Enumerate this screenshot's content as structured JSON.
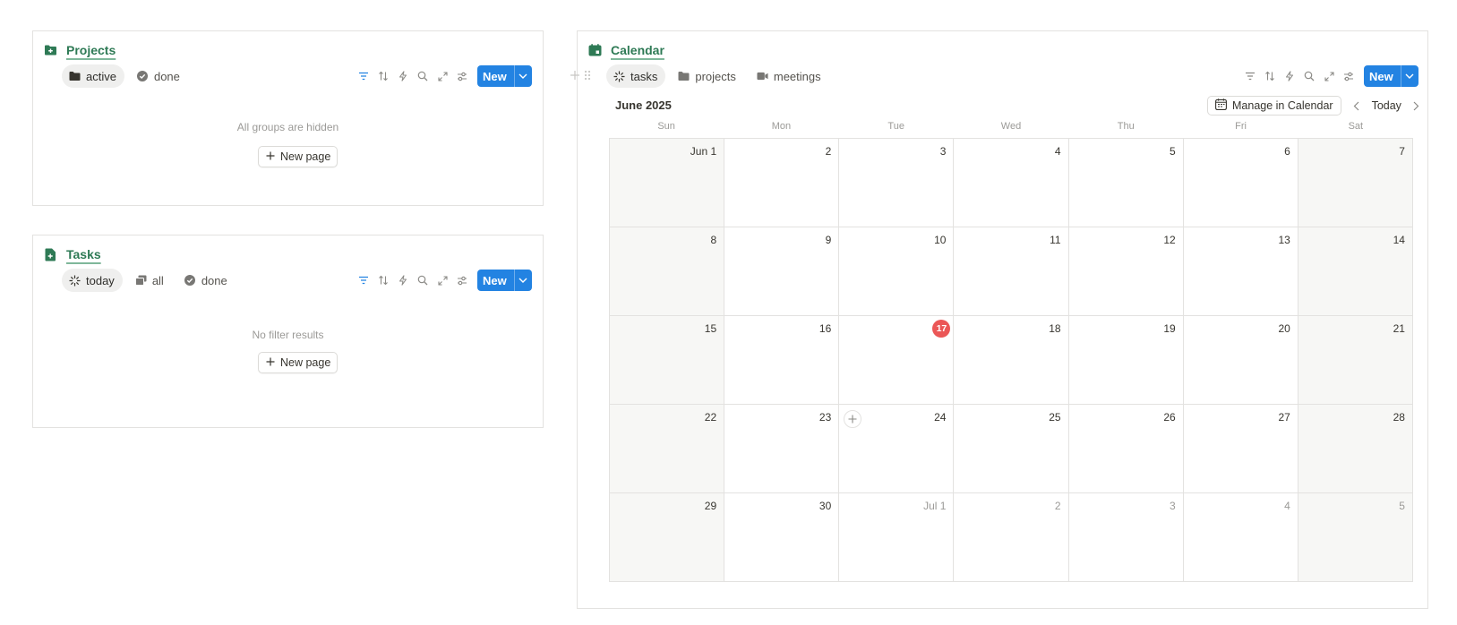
{
  "projects": {
    "title": "Projects",
    "tabs": [
      {
        "label": "active",
        "icon": "folder-icon",
        "active": true
      },
      {
        "label": "done",
        "icon": "check-circle-icon",
        "active": false
      }
    ],
    "new_label": "New",
    "empty_text": "All groups are hidden",
    "new_page_label": "New page"
  },
  "tasks": {
    "title": "Tasks",
    "tabs": [
      {
        "label": "today",
        "icon": "sparkle-icon",
        "active": true
      },
      {
        "label": "all",
        "icon": "stack-icon",
        "active": false
      },
      {
        "label": "done",
        "icon": "check-circle-icon",
        "active": false
      }
    ],
    "new_label": "New",
    "empty_text": "No filter results",
    "new_page_label": "New page"
  },
  "calendar": {
    "title": "Calendar",
    "tabs": [
      {
        "label": "tasks",
        "icon": "sparkle-icon",
        "active": true
      },
      {
        "label": "projects",
        "icon": "folder-icon",
        "active": false
      },
      {
        "label": "meetings",
        "icon": "video-icon",
        "active": false
      }
    ],
    "new_label": "New",
    "month_label": "June 2025",
    "manage_label": "Manage in Calendar",
    "today_label": "Today",
    "weekdays": [
      "Sun",
      "Mon",
      "Tue",
      "Wed",
      "Thu",
      "Fri",
      "Sat"
    ],
    "weeks": [
      [
        {
          "n": "Jun 1"
        },
        {
          "n": "2"
        },
        {
          "n": "3"
        },
        {
          "n": "4"
        },
        {
          "n": "5"
        },
        {
          "n": "6"
        },
        {
          "n": "7"
        }
      ],
      [
        {
          "n": "8"
        },
        {
          "n": "9"
        },
        {
          "n": "10"
        },
        {
          "n": "11"
        },
        {
          "n": "12"
        },
        {
          "n": "13"
        },
        {
          "n": "14"
        }
      ],
      [
        {
          "n": "15"
        },
        {
          "n": "16"
        },
        {
          "n": "17",
          "today": true
        },
        {
          "n": "18"
        },
        {
          "n": "19"
        },
        {
          "n": "20"
        },
        {
          "n": "21"
        }
      ],
      [
        {
          "n": "22"
        },
        {
          "n": "23"
        },
        {
          "n": "24",
          "hover_add": true
        },
        {
          "n": "25"
        },
        {
          "n": "26"
        },
        {
          "n": "27"
        },
        {
          "n": "28"
        }
      ],
      [
        {
          "n": "29"
        },
        {
          "n": "30"
        },
        {
          "n": "Jul 1",
          "other": true
        },
        {
          "n": "2",
          "other": true
        },
        {
          "n": "3",
          "other": true
        },
        {
          "n": "4",
          "other": true
        },
        {
          "n": "5",
          "other": true
        }
      ]
    ]
  },
  "colors": {
    "accent_blue": "#2383e2",
    "title_green": "#2e7a55",
    "today_red": "#eb5757"
  }
}
